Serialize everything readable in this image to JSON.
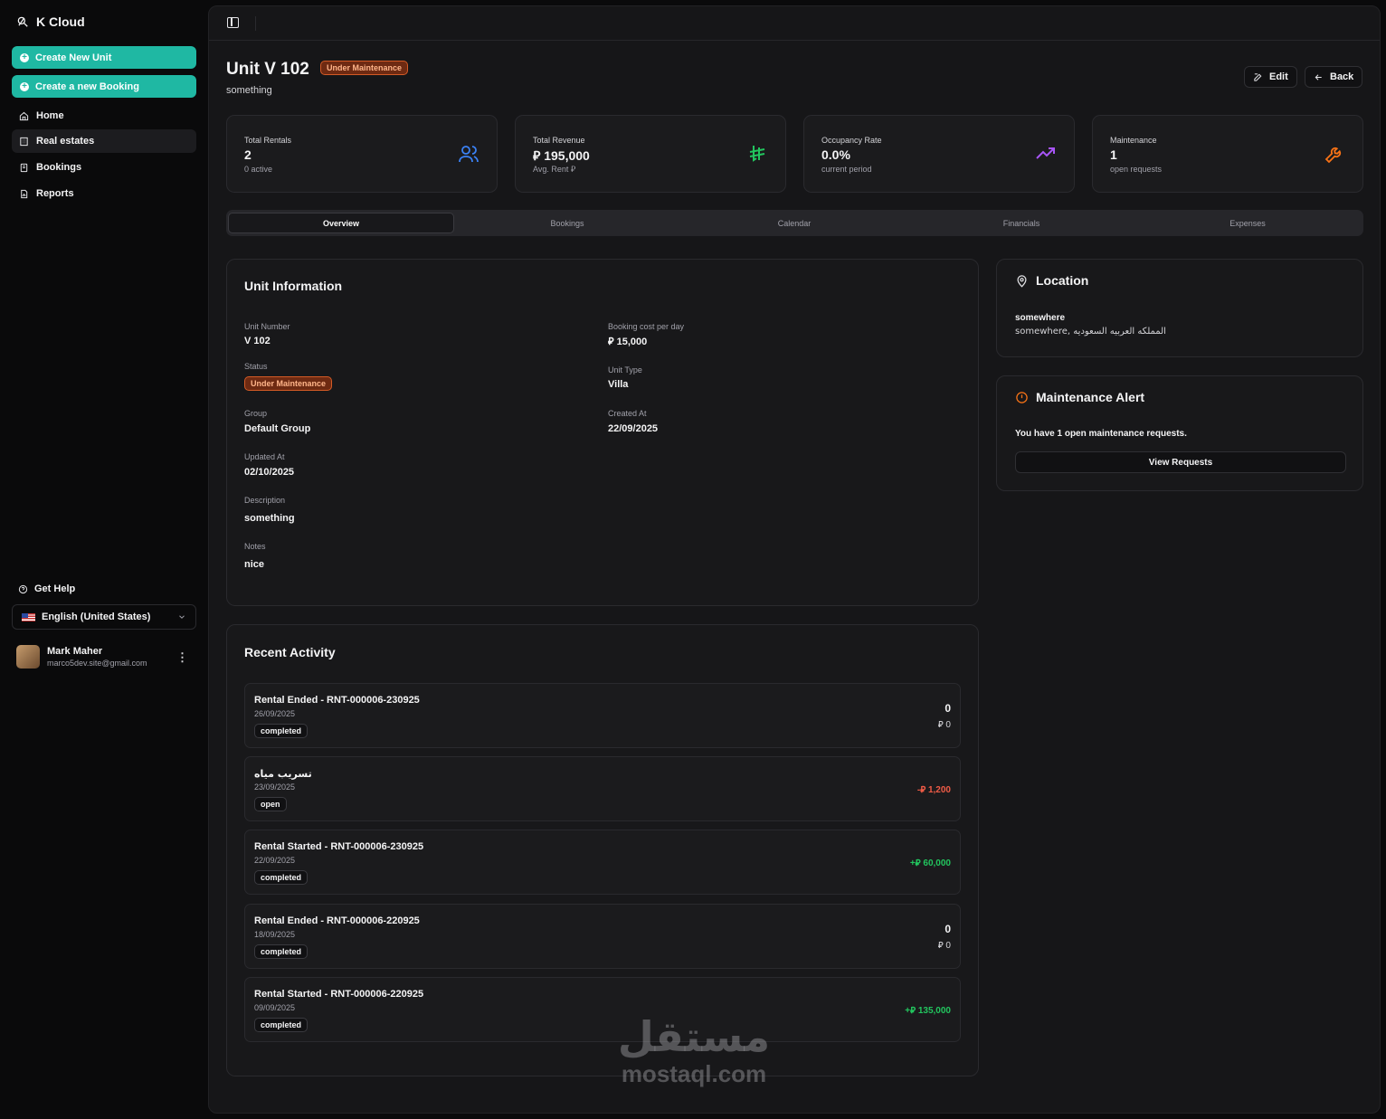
{
  "app": {
    "name": "K Cloud"
  },
  "sidebar": {
    "create_unit": "Create New Unit",
    "create_booking": "Create a new Booking",
    "items": [
      {
        "label": "Home",
        "icon": "home-icon"
      },
      {
        "label": "Real estates",
        "icon": "building-icon"
      },
      {
        "label": "Bookings",
        "icon": "book-icon"
      },
      {
        "label": "Reports",
        "icon": "report-icon"
      }
    ],
    "help": "Get Help",
    "language": "English (United States)",
    "user": {
      "name": "Mark Maher",
      "email": "marco5dev.site@gmail.com"
    }
  },
  "header": {
    "title": "Unit V 102",
    "status": "Under Maintenance",
    "subtitle": "something",
    "edit": "Edit",
    "back": "Back"
  },
  "stats": [
    {
      "label": "Total Rentals",
      "value": "2",
      "sub": "0 active",
      "icon": "users-icon",
      "color": "#3b82f6"
    },
    {
      "label": "Total Revenue",
      "value": "⃁ 195,000",
      "sub": "Avg. Rent ⃁",
      "icon": "riyal-icon",
      "color": "#22c55e"
    },
    {
      "label": "Occupancy Rate",
      "value": "0.0%",
      "sub": "current period",
      "icon": "trending-up-icon",
      "color": "#a855f7"
    },
    {
      "label": "Maintenance",
      "value": "1",
      "sub": "open requests",
      "icon": "wrench-icon",
      "color": "#f97316"
    }
  ],
  "tabs": [
    "Overview",
    "Bookings",
    "Calendar",
    "Financials",
    "Expenses"
  ],
  "unit_info": {
    "title": "Unit Information",
    "unit_number_label": "Unit Number",
    "unit_number": "V 102",
    "status_label": "Status",
    "status": "Under Maintenance",
    "group_label": "Group",
    "group": "Default Group",
    "updated_label": "Updated At",
    "updated": "02/10/2025",
    "description_label": "Description",
    "description": "something",
    "notes_label": "Notes",
    "notes": "nice",
    "cost_label": "Booking cost per day",
    "cost": "⃁ 15,000",
    "type_label": "Unit Type",
    "type": "Villa",
    "created_label": "Created At",
    "created": "22/09/2025"
  },
  "location": {
    "title": "Location",
    "name": "somewhere",
    "address": "somewhere, المملكه العربيه السعوديه"
  },
  "maintenance_alert": {
    "title": "Maintenance Alert",
    "text": "You have 1 open maintenance requests.",
    "button": "View Requests"
  },
  "recent_activity": {
    "title": "Recent Activity",
    "items": [
      {
        "title": "Rental Ended - RNT-000006-230925",
        "date": "26/09/2025",
        "status": "completed",
        "amount": "0",
        "amount_sub": "⃁ 0"
      },
      {
        "title": "تسريب مياه",
        "date": "23/09/2025",
        "status": "open",
        "amount": "-⃁ 1,200"
      },
      {
        "title": "Rental Started - RNT-000006-230925",
        "date": "22/09/2025",
        "status": "completed",
        "amount": "+⃁ 60,000"
      },
      {
        "title": "Rental Ended - RNT-000006-220925",
        "date": "18/09/2025",
        "status": "completed",
        "amount": "0",
        "amount_sub": "⃁ 0"
      },
      {
        "title": "Rental Started - RNT-000006-220925",
        "date": "09/09/2025",
        "status": "completed",
        "amount": "+⃁ 135,000"
      }
    ]
  },
  "watermark": {
    "arabic": "مستقل",
    "latin": "mostaql.com"
  }
}
